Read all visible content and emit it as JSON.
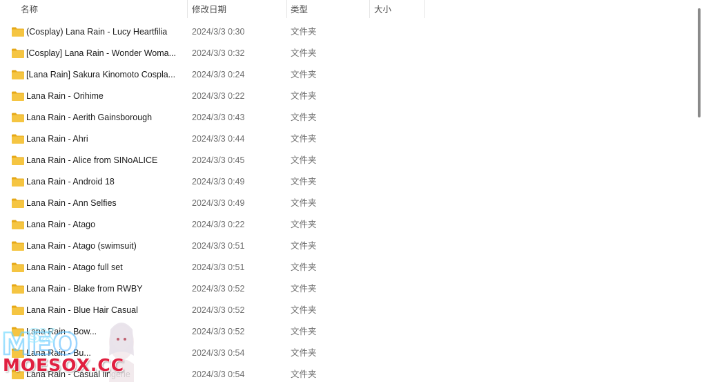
{
  "columns": {
    "name": "名称",
    "modified": "修改日期",
    "type": "类型",
    "size": "大小"
  },
  "sort": {
    "column": "name",
    "direction": "ascending",
    "icon": "chevron-up-icon"
  },
  "files": [
    {
      "name": "(Cosplay) Lana Rain - Lucy Heartfilia",
      "modified": "2024/3/3 0:30",
      "type": "文件夹"
    },
    {
      "name": "[Cosplay] Lana Rain - Wonder Woma...",
      "modified": "2024/3/3 0:32",
      "type": "文件夹"
    },
    {
      "name": "[Lana Rain] Sakura Kinomoto Cospla...",
      "modified": "2024/3/3 0:24",
      "type": "文件夹"
    },
    {
      "name": "Lana Rain  - Orihime",
      "modified": "2024/3/3 0:22",
      "type": "文件夹"
    },
    {
      "name": "Lana Rain - Aerith Gainsborough",
      "modified": "2024/3/3 0:43",
      "type": "文件夹"
    },
    {
      "name": "Lana Rain - Ahri",
      "modified": "2024/3/3 0:44",
      "type": "文件夹"
    },
    {
      "name": "Lana Rain - Alice from SINoALICE",
      "modified": "2024/3/3 0:45",
      "type": "文件夹"
    },
    {
      "name": "Lana Rain - Android 18",
      "modified": "2024/3/3 0:49",
      "type": "文件夹"
    },
    {
      "name": "Lana Rain - Ann Selfies",
      "modified": "2024/3/3 0:49",
      "type": "文件夹"
    },
    {
      "name": "Lana Rain - Atago",
      "modified": "2024/3/3 0:22",
      "type": "文件夹"
    },
    {
      "name": "Lana Rain - Atago (swimsuit)",
      "modified": "2024/3/3 0:51",
      "type": "文件夹"
    },
    {
      "name": "Lana Rain - Atago full set",
      "modified": "2024/3/3 0:51",
      "type": "文件夹"
    },
    {
      "name": "Lana Rain - Blake from RWBY",
      "modified": "2024/3/3 0:52",
      "type": "文件夹"
    },
    {
      "name": "Lana Rain - Blue Hair Casual",
      "modified": "2024/3/3 0:52",
      "type": "文件夹"
    },
    {
      "name": "Lana Rain - Bow...",
      "modified": "2024/3/3 0:52",
      "type": "文件夹"
    },
    {
      "name": "Lana Rain - Bu...",
      "modified": "2024/3/3 0:54",
      "type": "文件夹"
    },
    {
      "name": "Lana Rain - Casual lingerie",
      "modified": "2024/3/3 0:54",
      "type": "文件夹"
    }
  ],
  "watermark": {
    "text": "MOESOX.CC",
    "logo": "moesox-logo"
  },
  "colors": {
    "folder_body": "#f5c542",
    "folder_tab": "#e6a817",
    "header_text": "#4c4c4c",
    "secondary_text": "#6d6d6d",
    "watermark_red": "#e02040"
  }
}
